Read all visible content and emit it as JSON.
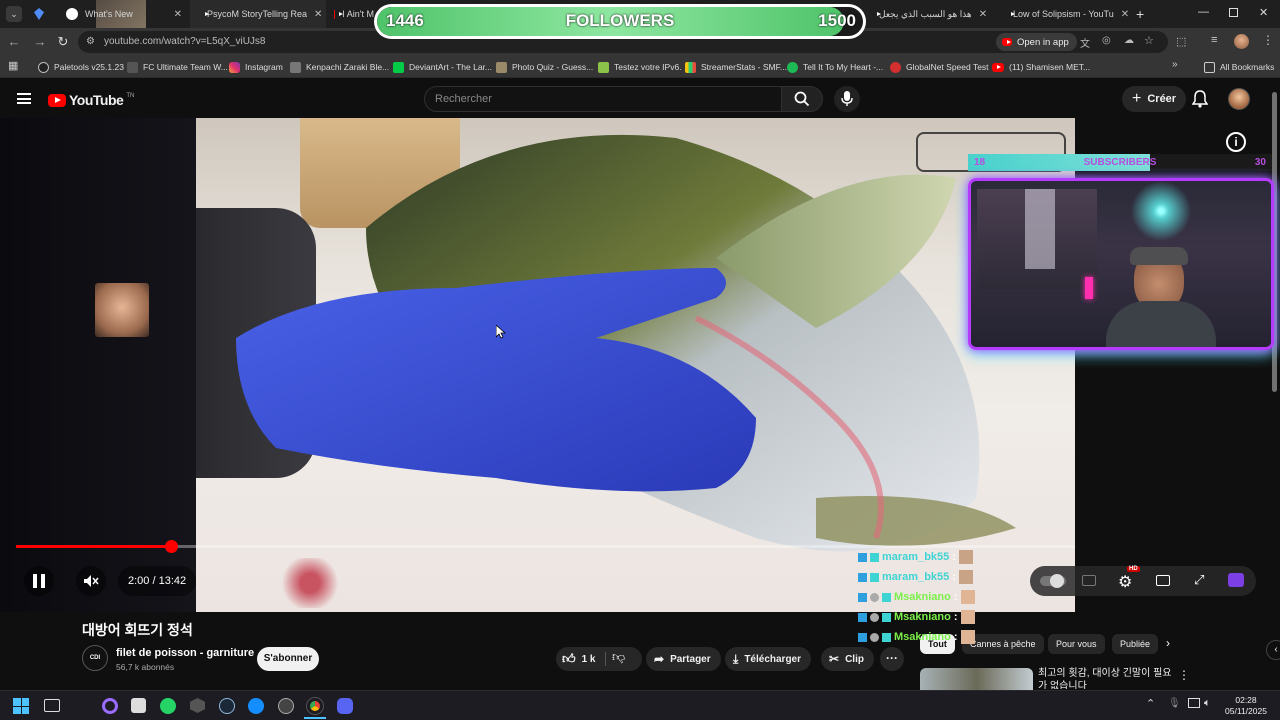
{
  "browser": {
    "tabs": [
      {
        "title": "What's New",
        "icon": "globe-icon"
      },
      {
        "title": "PsycoM StoryTelling Rea",
        "icon": "youtube-icon"
      },
      {
        "title": "I Ain't M",
        "icon": "youtube-icon"
      },
      {
        "title": "هذا هو السبب الذي يجعل",
        "icon": "youtube-icon"
      },
      {
        "title": "Low of Solipsism - YouTu",
        "icon": "youtube-icon"
      }
    ],
    "url": "youtube.com/watch?v=L5qX_viUJs8",
    "open_in_app": "Open in app",
    "bookmarks": [
      "Paletools v25.1.23",
      "FC Ultimate Team W...",
      "Instagram",
      "Kenpachi Zaraki Ble...",
      "DeviantArt - The Lar...",
      "Photo Quiz - Guess...",
      "Testez votre IPv6.",
      "StreamerStats - SMF...",
      "Tell It To My Heart -...",
      "GlobalNet Speed Test",
      "(11) Shamisen MET..."
    ],
    "all_bookmarks": "All Bookmarks"
  },
  "overlay": {
    "followers": {
      "current": "1446",
      "label": "FOLLOWERS",
      "goal": "1500",
      "progress": 0.96
    },
    "subscribers": {
      "current": "18",
      "label": "SUBSCRIBERS",
      "goal": "30",
      "progress": 0.6
    }
  },
  "youtube": {
    "logo_text": "YouTube",
    "logo_sup": "TN",
    "search_placeholder": "Rechercher",
    "create_label": "Créer",
    "player": {
      "time": "2:00 / 13:42",
      "progress": 0.146,
      "hd_badge": "HD"
    },
    "video_title": "대방어 회뜨기 정석",
    "channel": {
      "name": "filet de poisson - garniture",
      "subs": "56,7 k abonnés",
      "avatar_text": "CDI"
    },
    "subscribe_label": "S'abonner",
    "actions": {
      "likes": "1 k",
      "share": "Partager",
      "download": "Télécharger",
      "clip": "Clip"
    },
    "chips": [
      "Tout",
      "Cannes à pêche",
      "Pour vous",
      "Publiée"
    ],
    "suggested_title": "최고의 횟감, 대이상 긴말이 필요 가 없습니다"
  },
  "chat": [
    {
      "user": "maram_bk55",
      "color": "#3fd4d4"
    },
    {
      "user": "maram_bk55",
      "color": "#3fd4d4"
    },
    {
      "user": "Msakniano",
      "color": "#7cf04a"
    },
    {
      "user": "Msakniano",
      "color": "#7cf04a"
    },
    {
      "user": "Msakniano",
      "color": "#7cf04a"
    }
  ],
  "taskbar": {
    "time": "02:28",
    "date": "05/11/2025"
  },
  "colors": {
    "yt_red": "#ff0000",
    "glove_blue": "#3b53d6",
    "overlay_green": "#5fcf7a",
    "overlay_teal": "#4fd6d6",
    "webcam_border": "#b53cff"
  }
}
